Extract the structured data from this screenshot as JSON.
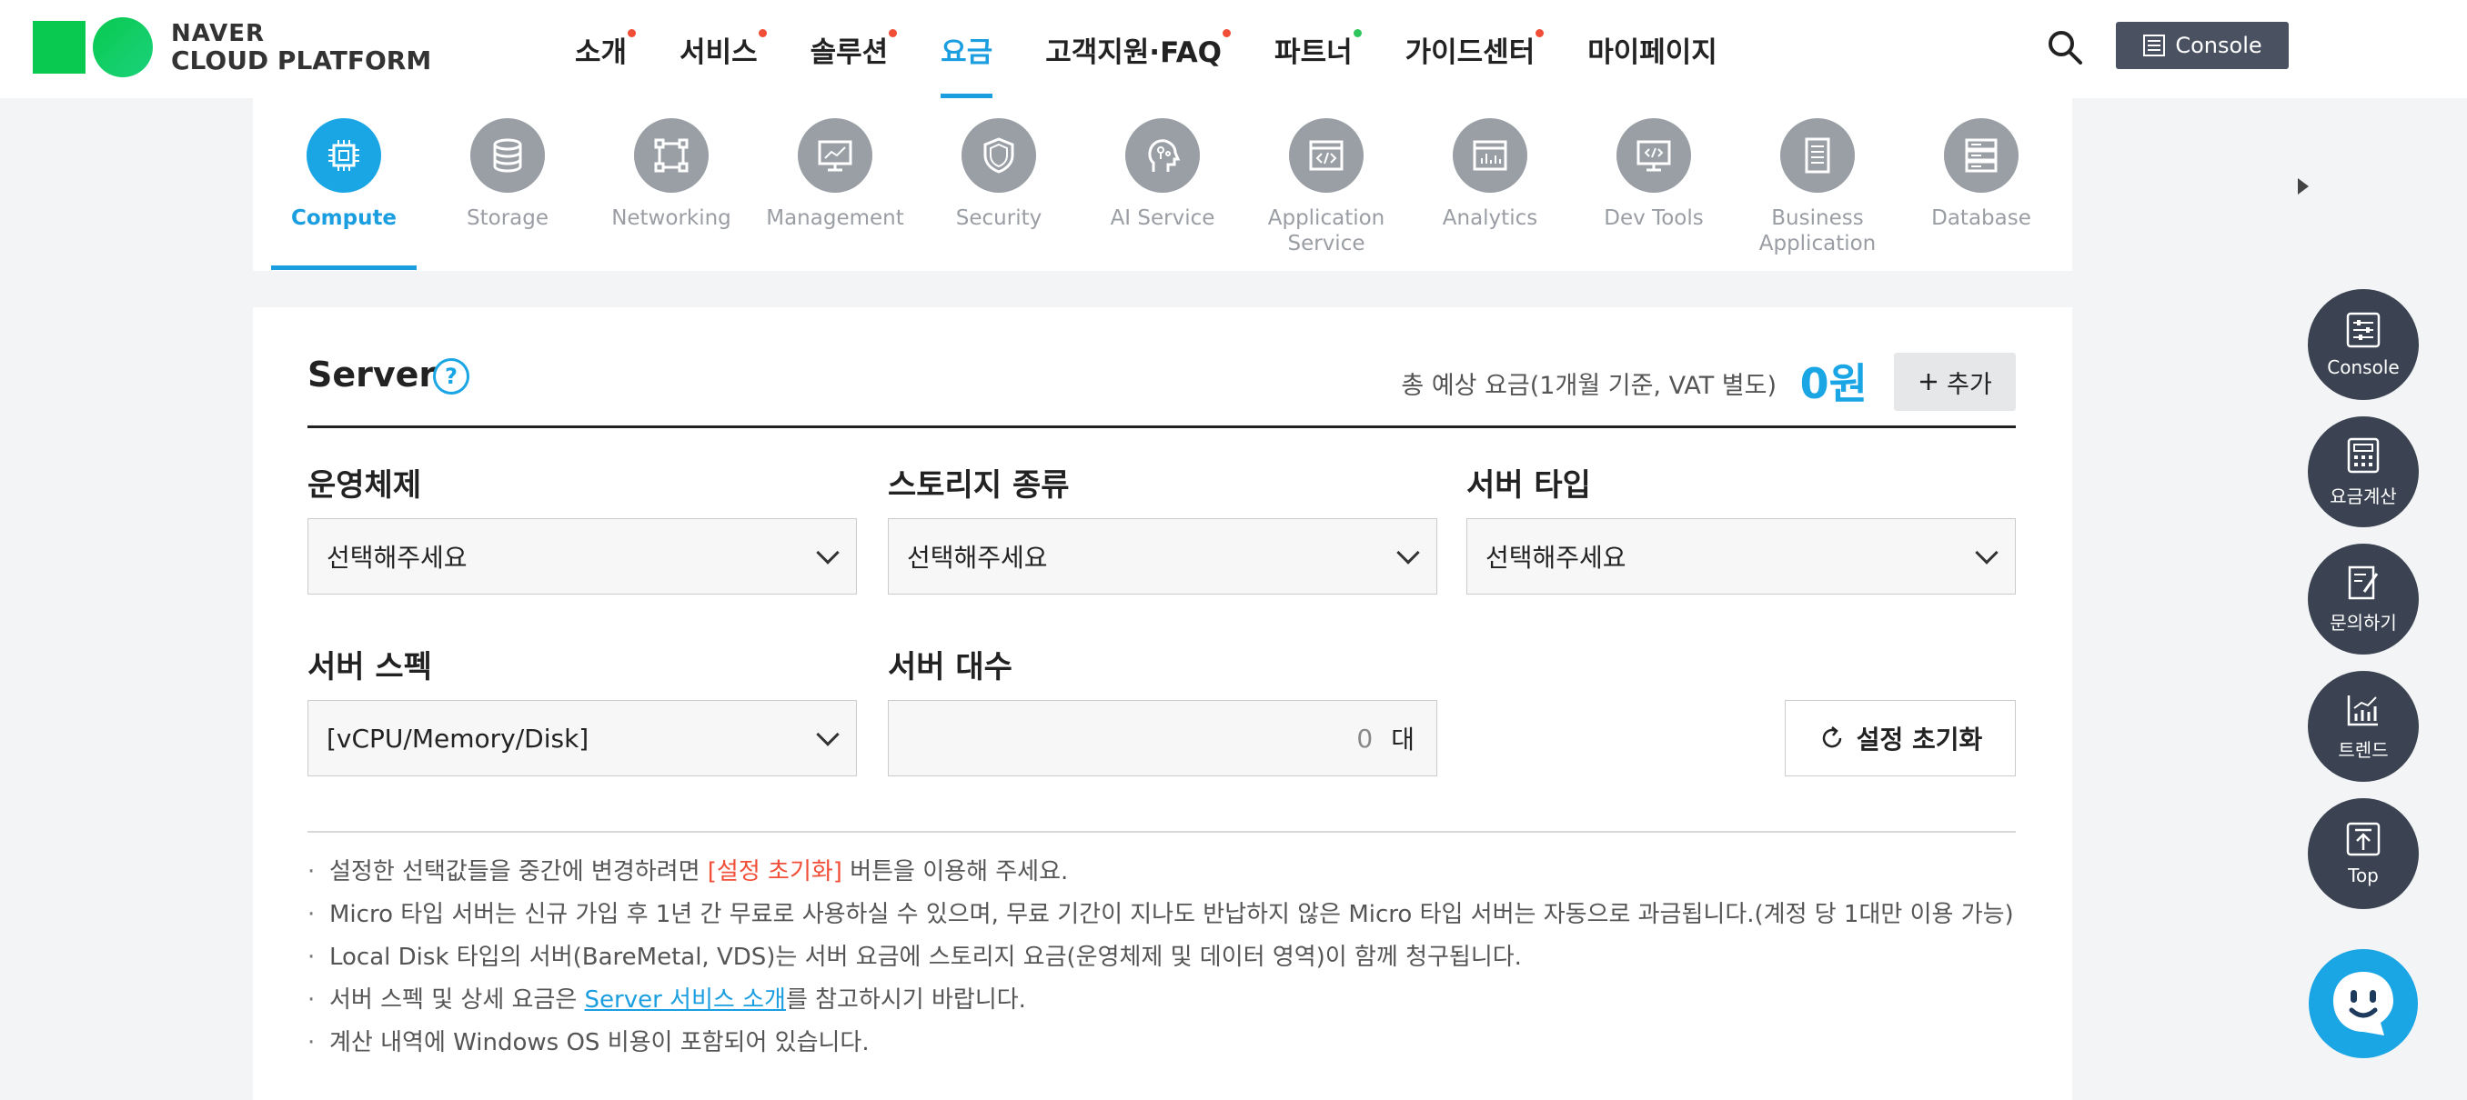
{
  "header": {
    "logo_line1": "NAVER",
    "logo_line2": "CLOUD PLATFORM",
    "nav": [
      {
        "label": "소개",
        "dot": "red"
      },
      {
        "label": "서비스",
        "dot": "red"
      },
      {
        "label": "솔루션",
        "dot": "red"
      },
      {
        "label": "요금",
        "dot": "none",
        "active": true
      },
      {
        "label": "고객지원·FAQ",
        "dot": "red"
      },
      {
        "label": "파트너",
        "dot": "green"
      },
      {
        "label": "가이드센터",
        "dot": "red"
      },
      {
        "label": "마이페이지",
        "dot": "none"
      }
    ],
    "console_label": "Console"
  },
  "categories": [
    {
      "label": "Compute",
      "icon": "chip-icon",
      "active": true
    },
    {
      "label": "Storage",
      "icon": "database-stack-icon"
    },
    {
      "label": "Networking",
      "icon": "network-icon"
    },
    {
      "label": "Management",
      "icon": "monitor-chart-icon"
    },
    {
      "label": "Security",
      "icon": "shield-icon"
    },
    {
      "label": "AI Service",
      "icon": "ai-head-icon"
    },
    {
      "label": "Application Service",
      "icon": "code-window-icon"
    },
    {
      "label": "Analytics",
      "icon": "analytics-window-icon"
    },
    {
      "label": "Dev Tools",
      "icon": "dev-monitor-icon"
    },
    {
      "label": "Business Application",
      "icon": "document-icon"
    },
    {
      "label": "Database",
      "icon": "server-rack-icon"
    }
  ],
  "panel": {
    "title": "Server",
    "help": "?",
    "total_label": "총 예상 요금(1개월 기준, VAT 별도)",
    "total_value": "0원",
    "add_label": "추가",
    "os_label": "운영체제",
    "os_value": "선택해주세요",
    "storage_label": "스토리지 종류",
    "storage_value": "선택해주세요",
    "server_type_label": "서버 타입",
    "server_type_value": "선택해주세요",
    "spec_label": "서버 스펙",
    "spec_value": "[vCPU/Memory/Disk]",
    "count_label": "서버 대수",
    "count_value": "0",
    "count_unit": "대",
    "reset_label": "설정 초기화"
  },
  "notes": {
    "n1_before": "설정한 선택값들을 중간에 변경하려면 ",
    "n1_red": "[설정 초기화]",
    "n1_after": " 버튼을 이용해 주세요.",
    "n2": "Micro 타입 서버는 신규 가입 후 1년 간 무료로 사용하실 수 있으며, 무료 기간이 지나도 반납하지 않은 Micro 타입 서버는 자동으로 과금됩니다.(계정 당 1대만 이용 가능)",
    "n3": "Local Disk 타입의 서버(BareMetal, VDS)는 서버 요금에 스토리지 요금(운영체제 및 데이터 영역)이 함께 청구됩니다.",
    "n4_before": "서버 스펙 및 상세 요금은 ",
    "n4_link": "Server 서비스 소개",
    "n4_after": "를 참고하시기 바랍니다.",
    "n5": "계산 내역에 Windows OS 비용이 포함되어 있습니다."
  },
  "floating": {
    "console": "Console",
    "calculator": "요금계산",
    "inquiry": "문의하기",
    "trend": "트렌드",
    "top": "Top"
  },
  "colors": {
    "accent": "#1a9ee0",
    "red_dot": "#f04e37",
    "green_dot": "#2fc45d",
    "float_bg": "#3b4352"
  }
}
